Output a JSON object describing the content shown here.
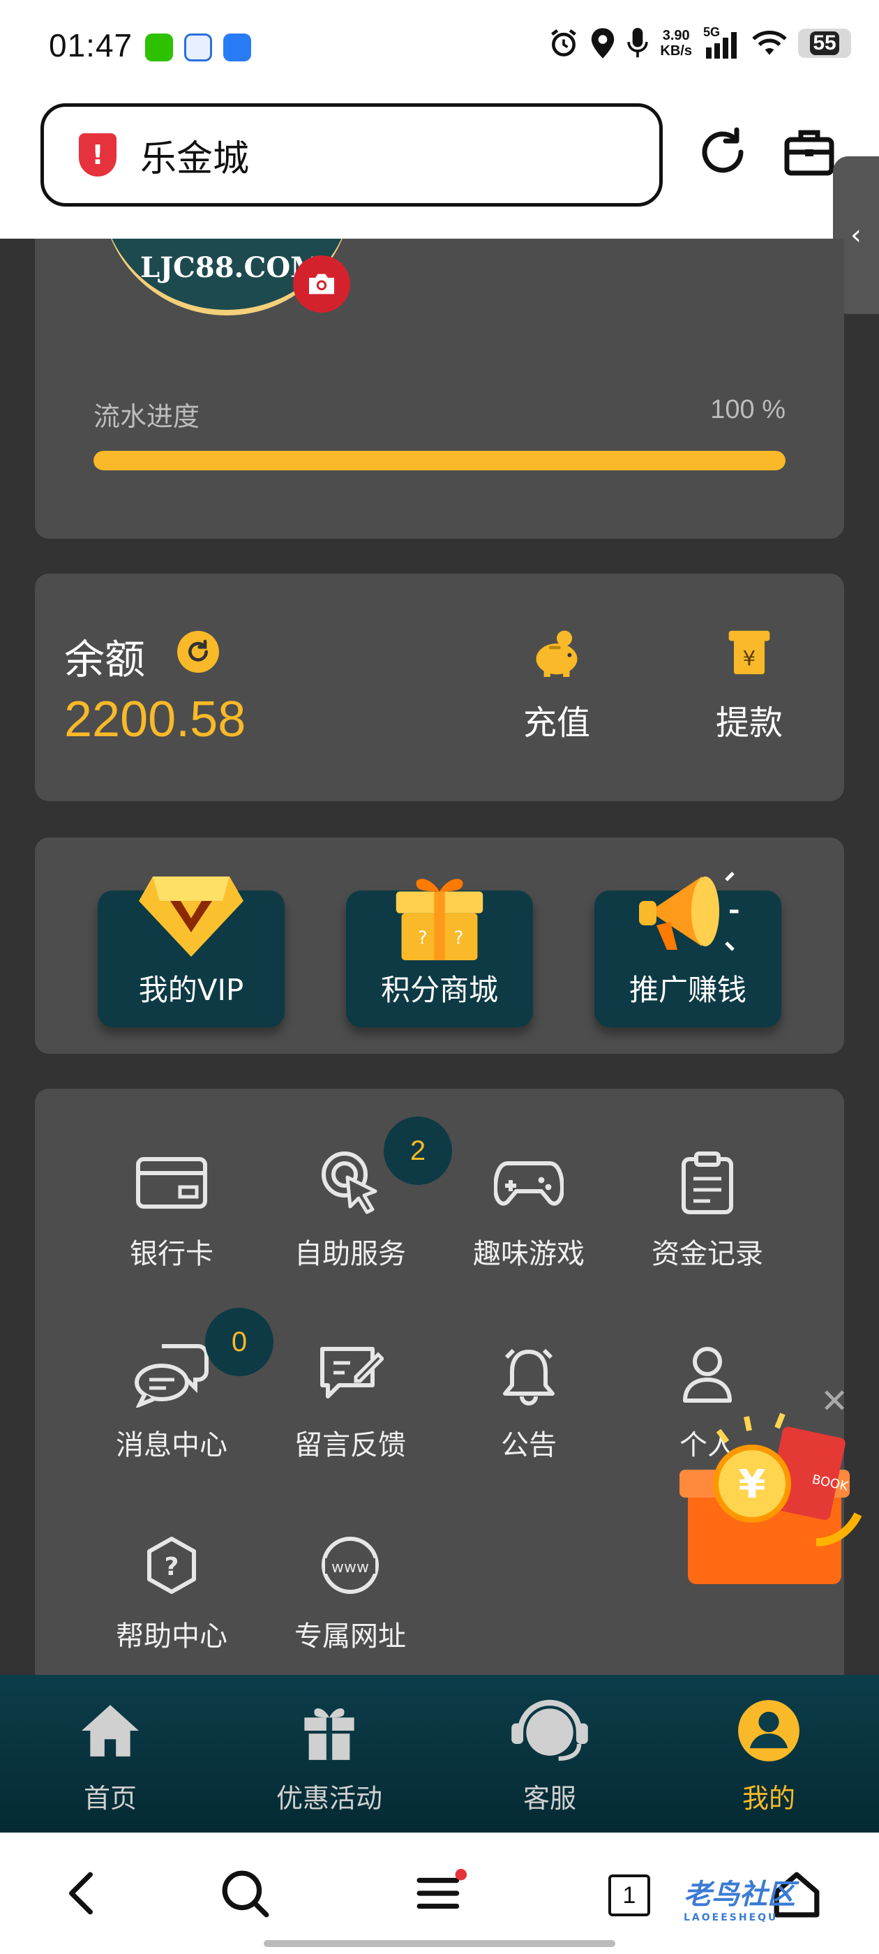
{
  "status": {
    "time": "01:47",
    "net_speed_value": "3.90",
    "net_speed_unit": "KB/s",
    "net_type": "5G",
    "battery": "55"
  },
  "browser": {
    "url_text": "乐金城",
    "shield_glyph": "!"
  },
  "profile": {
    "logo_text": "LJC88.COM",
    "progress_label": "流水进度",
    "progress_value": "100 %",
    "progress_fraction": 1.0
  },
  "wallet": {
    "balance_label": "余额",
    "balance_amount": "2200.58",
    "deposit_label": "充值",
    "withdraw_label": "提款"
  },
  "features": [
    {
      "label": "我的VIP",
      "icon": "vip-diamond-icon"
    },
    {
      "label": "积分商城",
      "icon": "gift-box-icon"
    },
    {
      "label": "推广赚钱",
      "icon": "megaphone-icon"
    }
  ],
  "menu": [
    {
      "label": "银行卡",
      "icon": "bank-card-icon"
    },
    {
      "label": "自助服务",
      "icon": "self-service-icon",
      "badge": "2"
    },
    {
      "label": "趣味游戏",
      "icon": "gamepad-icon"
    },
    {
      "label": "资金记录",
      "icon": "clipboard-icon"
    },
    {
      "label": "消息中心",
      "icon": "chat-bubbles-icon",
      "badge": "0"
    },
    {
      "label": "留言反馈",
      "icon": "feedback-icon"
    },
    {
      "label": "公告",
      "icon": "bell-icon"
    },
    {
      "label": "个人",
      "icon": "user-icon"
    },
    {
      "label": "帮助中心",
      "icon": "help-icon"
    },
    {
      "label": "专属网址",
      "icon": "www-globe-icon"
    }
  ],
  "promo": {
    "book_label": "BOOK",
    "currency_glyph": "¥"
  },
  "bottom_nav": [
    {
      "label": "首页",
      "icon": "home-icon"
    },
    {
      "label": "优惠活动",
      "icon": "gift-icon"
    },
    {
      "label": "客服",
      "icon": "headset-icon"
    },
    {
      "label": "我的",
      "icon": "profile-icon",
      "active": true
    }
  ],
  "system_nav": {
    "tab_count": "1",
    "watermark": "老鸟社区",
    "watermark_sub": "LAOEESHEQU"
  },
  "colors": {
    "accent": "#f9b928",
    "card": "#4d4d4d",
    "background": "#333333",
    "nav_dark": "#0c3d4a",
    "danger": "#d4222d"
  }
}
